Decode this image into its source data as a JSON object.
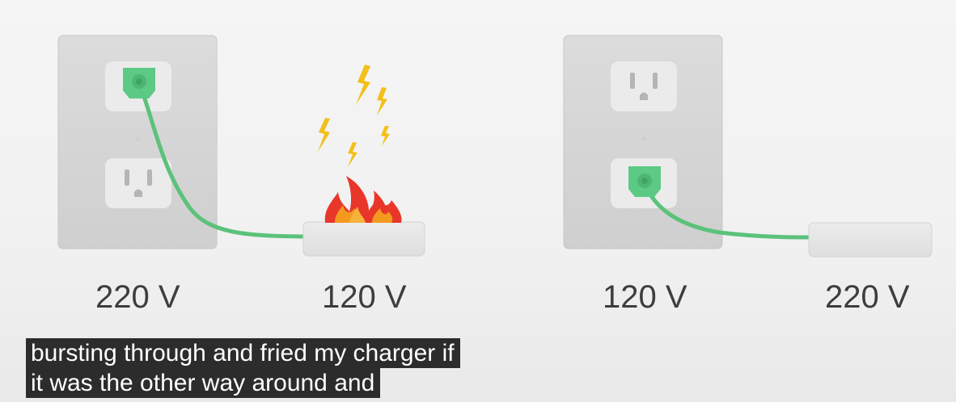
{
  "voltages": {
    "left_outlet": "220 V",
    "left_device": "120 V",
    "right_outlet": "120 V",
    "right_device": "220 V"
  },
  "captions": [
    "bursting through and fried my charger if",
    "it was the other way around and"
  ],
  "colors": {
    "plug_green": "#5cc985",
    "cord_green": "#5bc27a",
    "wall_plate": "#d6d6d6",
    "flame_red": "#e8372a",
    "flame_orange": "#f39a1e",
    "spark_yellow": "#f2c01a",
    "caption_bg": "#2c2c2c"
  },
  "icons": {
    "spark": "lightning-bolt-icon",
    "fire": "fire-icon"
  }
}
